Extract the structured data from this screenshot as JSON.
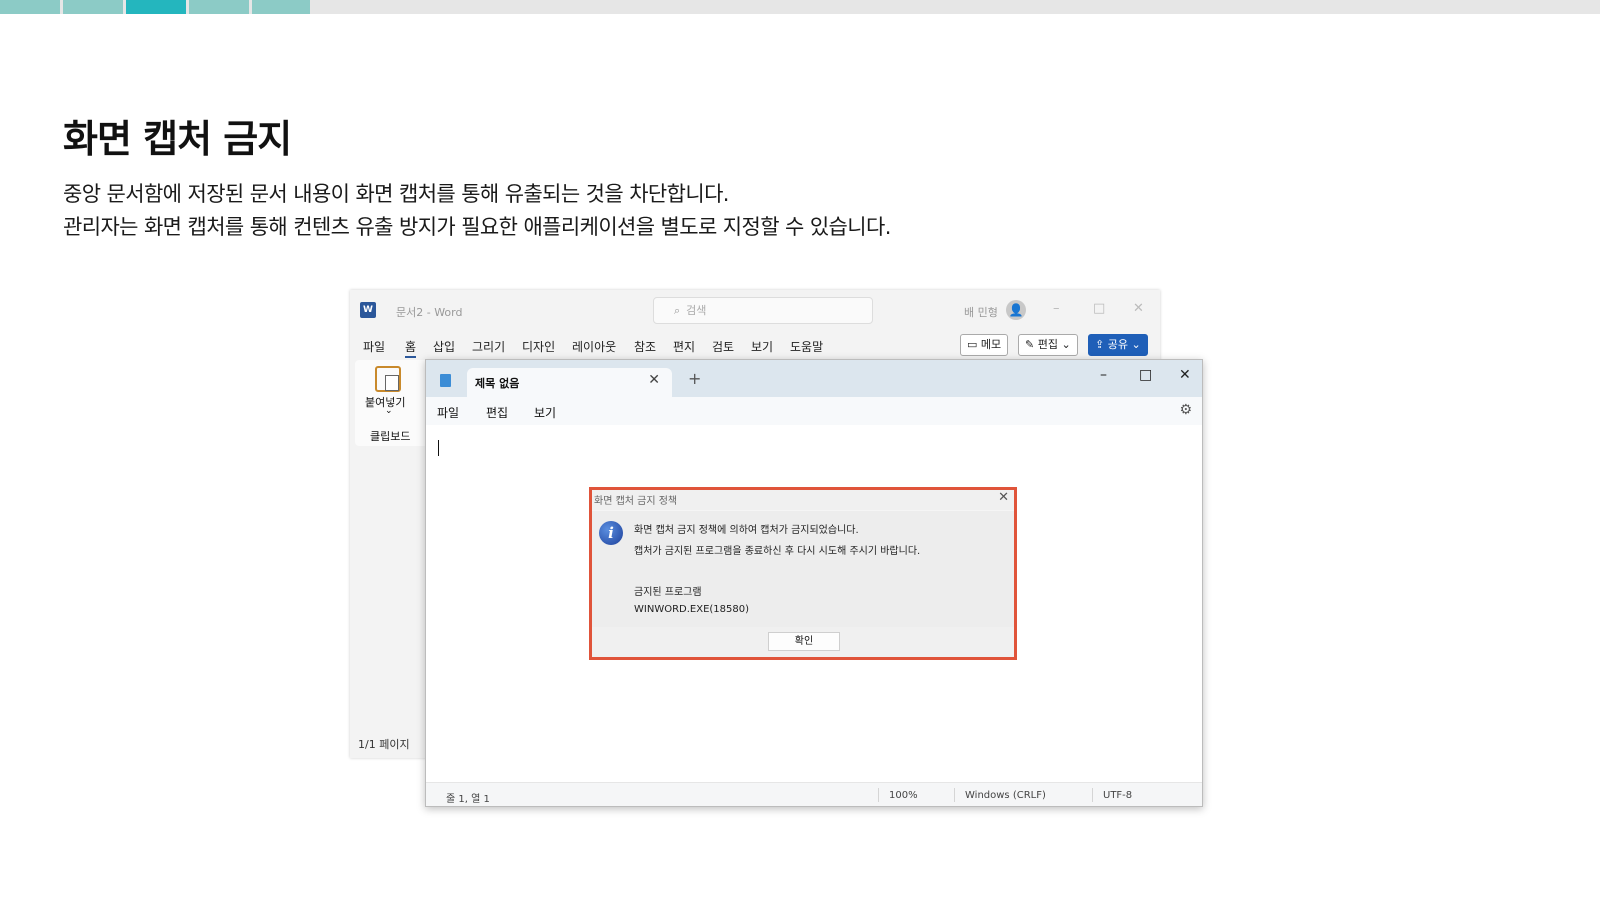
{
  "slide": {
    "title": "화면 캡처 금지",
    "desc_line1": "중앙 문서함에 저장된 문서 내용이 화면 캡처를 통해 유출되는 것을 차단합니다.",
    "desc_line2": "관리자는 화면 캡처를 통해 컨텐츠 유출 방지가 필요한 애플리케이션을 별도로 지정할 수 있습니다.",
    "strip_colors": [
      "#8ccbc6",
      "#8ccbc6",
      "#24b6be",
      "#8ccbc6",
      "#8ccbc6"
    ]
  },
  "word": {
    "logo": "W",
    "doc_title": "문서2 - Word",
    "search_placeholder": "검색",
    "search_icon": "search-icon",
    "user_name": "배 민형",
    "window_controls": [
      "–",
      "□",
      "✕"
    ],
    "menu": [
      "파일",
      "홈",
      "삽입",
      "그리기",
      "디자인",
      "레이아웃",
      "참조",
      "편지",
      "검토",
      "보기",
      "도움말"
    ],
    "active_menu": "홈",
    "memo_label": "메모",
    "edit_label": "편집",
    "share_label": "공유",
    "paste_label": "붙여넣기",
    "clipboard_label": "클립보드",
    "page_status": "1/1 페이지",
    "accent": "#2b579a"
  },
  "notepad": {
    "tab_title": "제목 없음",
    "new_tab": "+",
    "window_controls": [
      "–",
      "□",
      "✕"
    ],
    "menu": [
      "파일",
      "편집",
      "보기"
    ],
    "status": {
      "position": "줄 1, 열 1",
      "zoom": "100%",
      "line_ending": "Windows (CRLF)",
      "encoding": "UTF-8"
    }
  },
  "dialog": {
    "title": "화면 캡처 금지 정책",
    "close": "✕",
    "icon": "info-icon",
    "message_line1": "화면 캡처 금지 정책에 의하여 캡처가 금지되었습니다.",
    "message_line2": "캡처가 금지된 프로그램을 종료하신 후 다시 시도해 주시기 바랍니다.",
    "program_heading": "금지된 프로그램",
    "program_name": "WINWORD.EXE(18580)",
    "ok_label": "확인",
    "highlight_color": "#e0543a"
  }
}
